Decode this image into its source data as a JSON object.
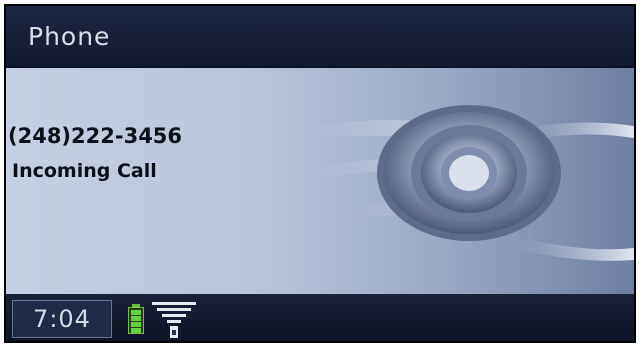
{
  "header": {
    "title": "Phone"
  },
  "call": {
    "number": "(248)222-3456",
    "status": "Incoming Call"
  },
  "footer": {
    "time": "7:04",
    "battery_level": 1.0,
    "signal_level": 1.0
  },
  "colors": {
    "background": "#0b1226",
    "content_panel": "#c6d0e3",
    "battery_green": "#5fd33a"
  },
  "icons": {
    "battery": "battery-icon",
    "signal": "signal-icon",
    "logo": "winged-emblem-logo"
  }
}
